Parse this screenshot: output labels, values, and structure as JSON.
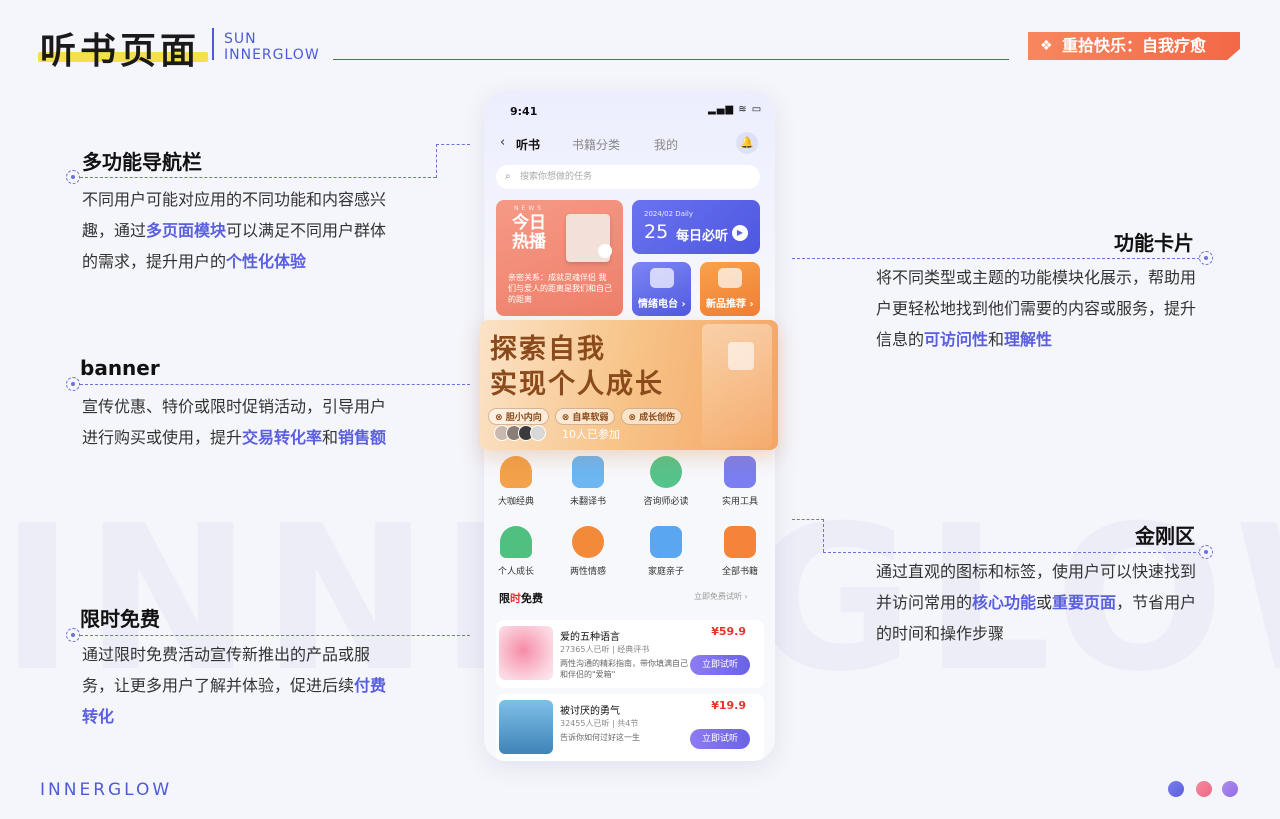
{
  "header": {
    "title": "听书页面",
    "brand_line1": "SUN",
    "brand_line2": "INNERGLOW",
    "tag_label": "重拾快乐：自我疗愈"
  },
  "watermark": "INNERGLOW",
  "annotations": {
    "nav": {
      "title": "多功能导航栏",
      "text_a": "不同用户可能对应用的不同功能和内容感兴趣，通过",
      "hl_a": "多页面模块",
      "text_b": "可以满足不同用户群体的需求，提升用户的",
      "hl_b": "个性化体验"
    },
    "banner": {
      "title": "banner",
      "text_a": "宣传优惠、特价或限时促销活动，引导用户进行购买或使用，提升",
      "hl_a": "交易转化率",
      "text_b": "和",
      "hl_b": "销售额"
    },
    "free": {
      "title": "限时免费",
      "text_a": "通过限时免费活动宣传新推出的产品或服务，让更多用户了解并体验，促进后续",
      "hl_a": "付费转化"
    },
    "cards": {
      "title": "功能卡片",
      "text_a": "将不同类型或主题的功能模块化展示，帮助用户更轻松地找到他们需要的内容或服务，提升信息的",
      "hl_a": "可访问性",
      "text_b": "和",
      "hl_b": "理解性"
    },
    "kingkong": {
      "title": "金刚区",
      "text_a": "通过直观的图标和标签，使用户可以快速找到并访问常用的",
      "hl_a": "核心功能",
      "text_b": "或",
      "hl_b": "重要页面",
      "text_c": "，节省用户的时间和操作步骤"
    }
  },
  "phone": {
    "status_time": "9:41",
    "status_icons": "▂▄▆ ≋ ▭",
    "nav_tabs": [
      "听书",
      "书籍分类",
      "我的"
    ],
    "search_placeholder": "搜索你想做的任务",
    "news_card": {
      "sub": "NEWS",
      "title": "今日热播",
      "desc": "亲密关系：成就灵魂伴侣 我们与爱人的距离是我们和自己的距离"
    },
    "daily_card": {
      "date": "2024/02  Daily",
      "day": "25",
      "label": "每日必听"
    },
    "radio_card": {
      "label": "情绪电台 ›"
    },
    "new_card": {
      "label": "新品推荐 ›"
    },
    "banner": {
      "title_line1": "探索自我",
      "title_line2": "实现个人成长",
      "tags": [
        "胆小内向",
        "自卑软弱",
        "成长创伤"
      ],
      "join": "10人已参加"
    },
    "kingkong": [
      {
        "label": "大咖经典",
        "color": "#f3a14a"
      },
      {
        "label": "未翻译书",
        "color": "#6cb6f2"
      },
      {
        "label": "咨询师必读",
        "color": "#55c48a"
      },
      {
        "label": "实用工具",
        "color": "#7a7ef0"
      },
      {
        "label": "个人成长",
        "color": "#4fc07f"
      },
      {
        "label": "两性情感",
        "color": "#f38a3a"
      },
      {
        "label": "家庭亲子",
        "color": "#5aa6f0"
      },
      {
        "label": "全部书籍",
        "color": "#f5843a"
      }
    ],
    "free_section": {
      "title_a": "限",
      "title_b": "时",
      "title_c": "免费",
      "more": "立即免费试听 ›"
    },
    "free_items": [
      {
        "name": "爱的五种语言",
        "meta": "27365人已听 | 经典评书",
        "desc": "两性沟通的精彩指南，带你填满自己和伴侣的\"爱箱\"",
        "price": "¥59.9",
        "button": "立即试听"
      },
      {
        "name": "被讨厌的勇气",
        "meta": "32455人已听 | 共4节",
        "desc": "告诉你如何过好这一生",
        "price": "¥19.9",
        "button": "立即试听"
      }
    ]
  },
  "footer": {
    "brand": "INNERGLOW",
    "dot_colors": [
      "#6d72e8",
      "#f0708a",
      "#9a7ae8"
    ]
  }
}
